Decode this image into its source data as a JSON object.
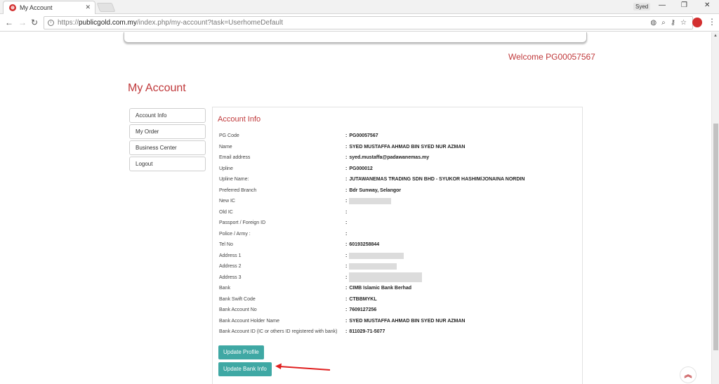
{
  "browser": {
    "tab_title": "My Account",
    "tab_close": "✕",
    "profile_name": "Syed",
    "url_protocol": "https://",
    "url_domain": "publicgold.com.my",
    "url_path": "/index.php/my-account?task=UserhomeDefault"
  },
  "header": {
    "welcome": "Welcome PG00057567"
  },
  "page": {
    "title": "My Account"
  },
  "sidebar": {
    "items": [
      {
        "label": "Account Info"
      },
      {
        "label": "My Order"
      },
      {
        "label": "Business Center"
      },
      {
        "label": "Logout"
      }
    ]
  },
  "account": {
    "section_title": "Account Info",
    "rows": [
      {
        "label": "PG Code",
        "value": "PG00057567",
        "redacted": false
      },
      {
        "label": "Name",
        "value": "SYED MUSTAFFA AHMAD BIN SYED NUR AZMAN",
        "redacted": false
      },
      {
        "label": "Email address",
        "value": "syed.mustaffa@padawanemas.my",
        "redacted": false
      },
      {
        "label": "Upline",
        "value": "PG000012",
        "redacted": false
      },
      {
        "label": "Upline Name:",
        "value": "JUTAWANEMAS TRADING SDN BHD - SYUKOR HASHIM/JONAINA NORDIN",
        "redacted": false
      },
      {
        "label": "Preferred Branch",
        "value": "Bdr Sunway, Selangor",
        "redacted": false
      },
      {
        "label": "New IC",
        "value": "",
        "redacted": true
      },
      {
        "label": "Old IC",
        "value": "",
        "redacted": false
      },
      {
        "label": "Passport / Foreign ID",
        "value": "",
        "redacted": false
      },
      {
        "label": "Police / Army :",
        "value": "",
        "redacted": false
      },
      {
        "label": "Tel No",
        "value": "60193258844",
        "redacted": false
      },
      {
        "label": "Address 1",
        "value": "",
        "redacted": true
      },
      {
        "label": "Address 2",
        "value": "",
        "redacted": true
      },
      {
        "label": "Address 3",
        "value": "",
        "redacted": true
      },
      {
        "label": "Bank",
        "value": "CIMB Islamic Bank Berhad",
        "redacted": false
      },
      {
        "label": "Bank Swift Code",
        "value": "CTBBMYKL",
        "redacted": false
      },
      {
        "label": "Bank Account No",
        "value": "7609127256",
        "redacted": false
      },
      {
        "label": "Bank Account Holder Name",
        "value": "SYED MUSTAFFA AHMAD BIN SYED NUR AZMAN",
        "redacted": false
      },
      {
        "label": "Bank Account ID (IC or others ID registered with bank)",
        "value": "811029-71-5077",
        "redacted": false
      }
    ],
    "update_profile_label": "Update Profile",
    "update_bank_label": "Update Bank Info"
  },
  "colors": {
    "accent_red": "#c0393b",
    "button_teal": "#3fa8a4"
  },
  "icons": {
    "scroll_top": "double-chevron-up"
  }
}
